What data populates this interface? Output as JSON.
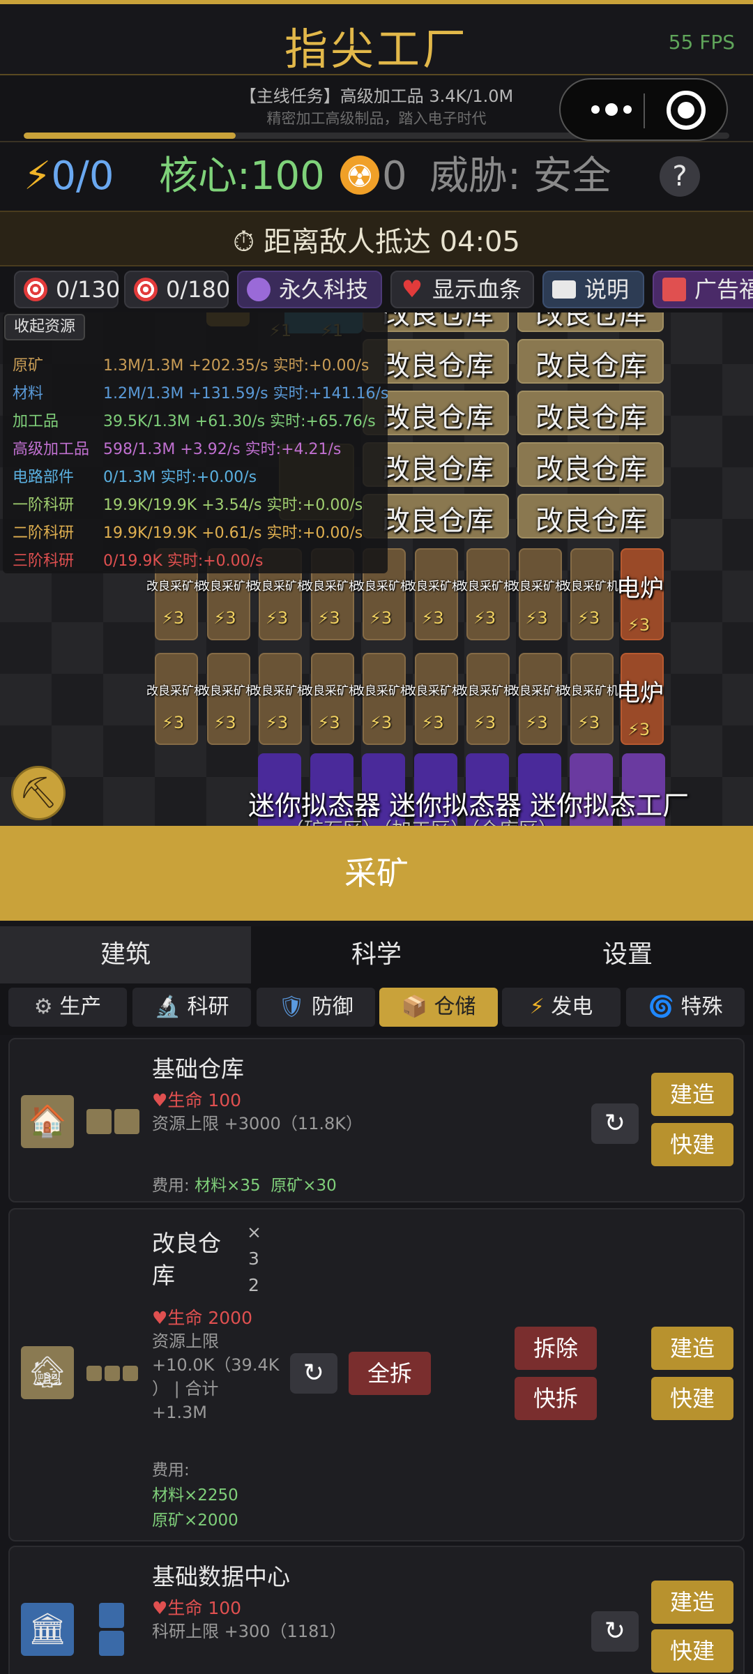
{
  "app": {
    "title": "指尖工厂",
    "fps": "55 FPS"
  },
  "mission": {
    "title": "【主线任务】高级加工品 3.4K/1.0M",
    "subtitle": "精密加工高级制品，踏入电子时代",
    "progress": 0.3
  },
  "stats": {
    "power_icon": "⚡",
    "power": "0/0",
    "core": "核心:100",
    "radiation": "0",
    "threat": "威胁: 安全",
    "help": "?"
  },
  "enemy": {
    "text": "距离敌人抵达  04:05"
  },
  "quick_buttons": {
    "target1": "0/130",
    "target2": "0/180",
    "tech": "永久科技",
    "hp": "显示血条",
    "guide": "说明",
    "gift": "广告福"
  },
  "resources": {
    "title": "收起资源",
    "rows": [
      {
        "name": "原矿",
        "value": "1.3M/1.3M +202.35/s 实时:+0.00/s",
        "color": "#c89c55"
      },
      {
        "name": "材料",
        "value": "1.2M/1.3M +131.59/s 实时:+141.16/s",
        "color": "#5a9ad8"
      },
      {
        "name": "加工品",
        "value": "39.5K/1.3M +61.30/s 实时:+65.76/s",
        "color": "#7fcf7a"
      },
      {
        "name": "高级加工品",
        "value": "598/1.3M +3.92/s 实时:+4.21/s",
        "color": "#c070d0"
      },
      {
        "name": "电路部件",
        "value": "0/1.3M 实时:+0.00/s",
        "color": "#5ab0e0"
      },
      {
        "name": "一阶科研",
        "value": "19.9K/19.9K +3.54/s 实时:+0.00/s",
        "color": "#a0cf70"
      },
      {
        "name": "二阶科研",
        "value": "19.9K/19.9K +0.61/s 实时:+0.00/s",
        "color": "#e0b050"
      },
      {
        "name": "三阶科研",
        "value": "0/19.9K 实时:+0.00/s",
        "color": "#e05050"
      }
    ]
  },
  "map": {
    "warehouse_label": "改良仓库",
    "miner_label": "改良采矿机",
    "bolt_label": "⚡3",
    "bolt1_label": "⚡1",
    "furnace_label": "电炉",
    "zone_label": "迷你拟态器 迷你拟态器 迷你拟态工厂",
    "zone_sub": "（矿石区）（加工区）（仓库区）"
  },
  "mine_button": "采矿",
  "main_tabs": [
    "建筑",
    "科学",
    "设置"
  ],
  "sub_tabs": [
    {
      "label": "生产",
      "icon": "⚙"
    },
    {
      "label": "科研",
      "icon": "🔬"
    },
    {
      "label": "防御",
      "icon": "🛡"
    },
    {
      "label": "仓储",
      "icon": "📦"
    },
    {
      "label": "发电",
      "icon": "⚡"
    },
    {
      "label": "特殊",
      "icon": "🌀"
    }
  ],
  "cards": [
    {
      "name": "基础仓库",
      "hp": "♥生命 100",
      "desc": "资源上限 +3000（11.8K）",
      "cost_label": "费用:",
      "cost1": "材料×35",
      "cost2": "原矿×30",
      "build": "建造",
      "quick": "快建"
    },
    {
      "name_line1": "改良仓",
      "name_line2": "库",
      "mult": [
        "×",
        "3",
        "2"
      ],
      "hp": "♥生命 2000",
      "desc1": "资源上限",
      "desc2": "+10.0K（39.4K",
      "desc3": "） | 合计",
      "desc4": "+1.3M",
      "dismantle_all": "全拆",
      "dismantle": "拆除",
      "quick_dismantle": "快拆",
      "cost_label": "费用:",
      "cost1": "材料×2250",
      "cost2": "原矿×2000",
      "build": "建造",
      "quick": "快建"
    },
    {
      "name": "基础数据中心",
      "hp": "♥生命 100",
      "desc": "科研上限 +300（1181）",
      "build": "建造",
      "quick": "快建"
    }
  ],
  "icons": {
    "refresh": "↻",
    "pickaxe": "⛏",
    "timer": "⏱"
  }
}
